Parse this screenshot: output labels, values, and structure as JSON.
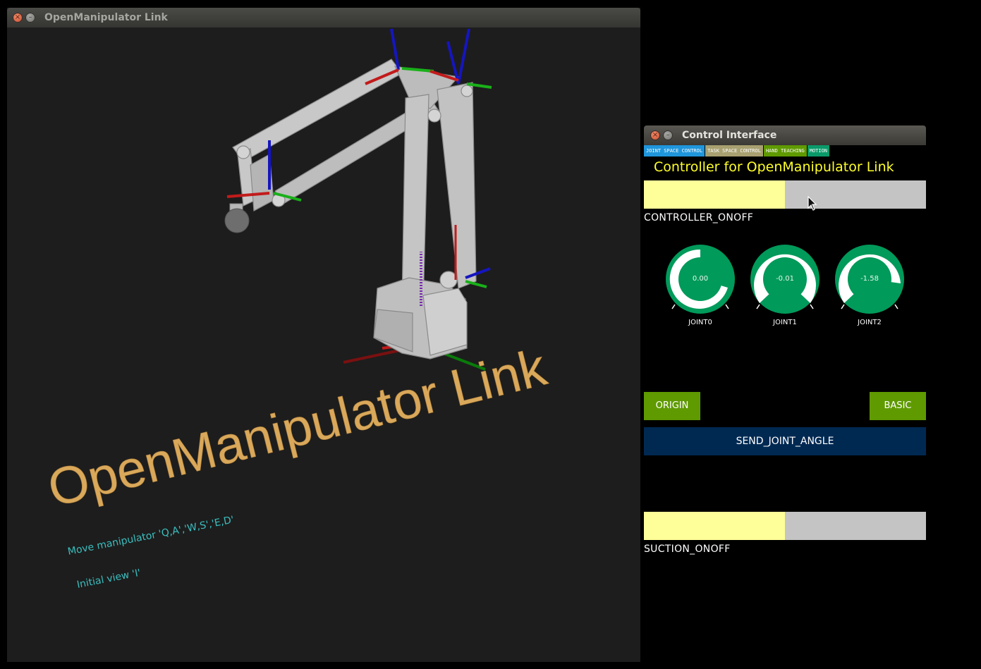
{
  "viewer": {
    "window_title": "OpenManipulator Link",
    "scene_title": "OpenManipulator Link",
    "hints": [
      "Move manipulator 'Q,A','W,S','E,D'",
      "Initial view 'I'"
    ],
    "text_color": "#d9a85a",
    "hint_color": "#3bbfc0"
  },
  "control": {
    "window_title": "Control Interface",
    "tabs": [
      {
        "label": "JOINT SPACE CONTROL",
        "color": "#1f96dc"
      },
      {
        "label": "TASK SPACE CONTROL",
        "color": "#a8a070"
      },
      {
        "label": "HAND TEACHING",
        "color": "#5f9a00"
      },
      {
        "label": "MOTION",
        "color": "#0a9a6a"
      }
    ],
    "heading": "Controller for OpenManipulator Link",
    "controller_toggle_label": "CONTROLLER_ONOFF",
    "knobs": [
      {
        "label": "JOINT0",
        "value": "0.00"
      },
      {
        "label": "JOINT1",
        "value": "-0.01"
      },
      {
        "label": "JOINT2",
        "value": "-1.58"
      }
    ],
    "origin_label": "ORIGIN",
    "basic_label": "BASIC",
    "send_label": "SEND_JOINT_ANGLE",
    "suction_toggle_label": "SUCTION_ONOFF",
    "knob_color": "#009a5a"
  }
}
